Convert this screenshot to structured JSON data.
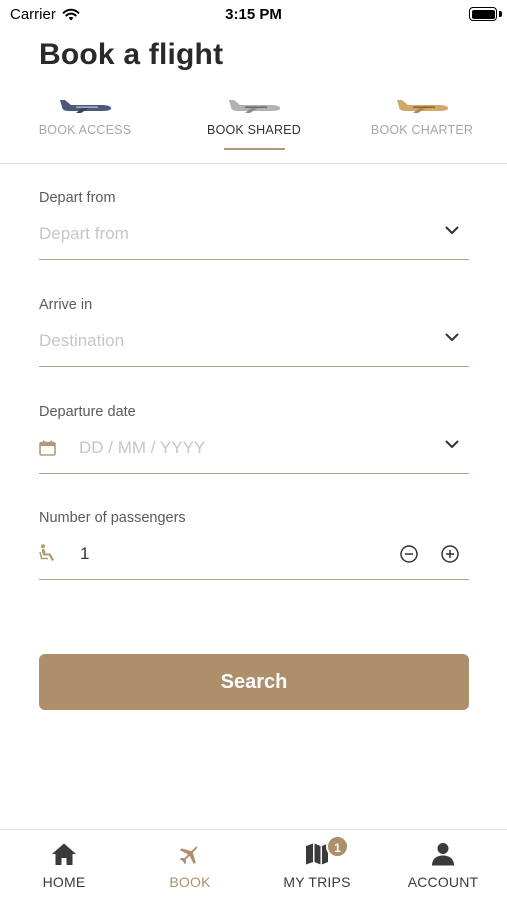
{
  "status_bar": {
    "carrier": "Carrier",
    "time": "3:15 PM"
  },
  "page": {
    "title": "Book a flight"
  },
  "tabs": [
    {
      "label": "BOOK ACCESS",
      "active": false,
      "plane_color": "#4c5a78"
    },
    {
      "label": "BOOK SHARED",
      "active": true,
      "plane_color": "#a9a9a9"
    },
    {
      "label": "BOOK CHARTER",
      "active": false,
      "plane_color": "#c9a062"
    }
  ],
  "form": {
    "depart": {
      "label": "Depart from",
      "placeholder": "Depart from",
      "value": ""
    },
    "arrive": {
      "label": "Arrive in",
      "placeholder": "Destination",
      "value": ""
    },
    "date": {
      "label": "Departure date",
      "placeholder": "DD / MM / YYYY",
      "value": ""
    },
    "passengers": {
      "label": "Number of passengers",
      "value": "1"
    }
  },
  "search_button": {
    "label": "Search"
  },
  "bottom_nav": {
    "items": [
      {
        "label": "HOME",
        "icon": "home-icon",
        "active": false
      },
      {
        "label": "BOOK",
        "icon": "plane-icon",
        "active": true
      },
      {
        "label": "MY TRIPS",
        "icon": "map-icon",
        "active": false,
        "badge": "1"
      },
      {
        "label": "ACCOUNT",
        "icon": "person-icon",
        "active": false
      }
    ]
  },
  "colors": {
    "accent": "#ae8f6c",
    "underline": "#b6a182",
    "placeholder": "#c6c6c6"
  }
}
